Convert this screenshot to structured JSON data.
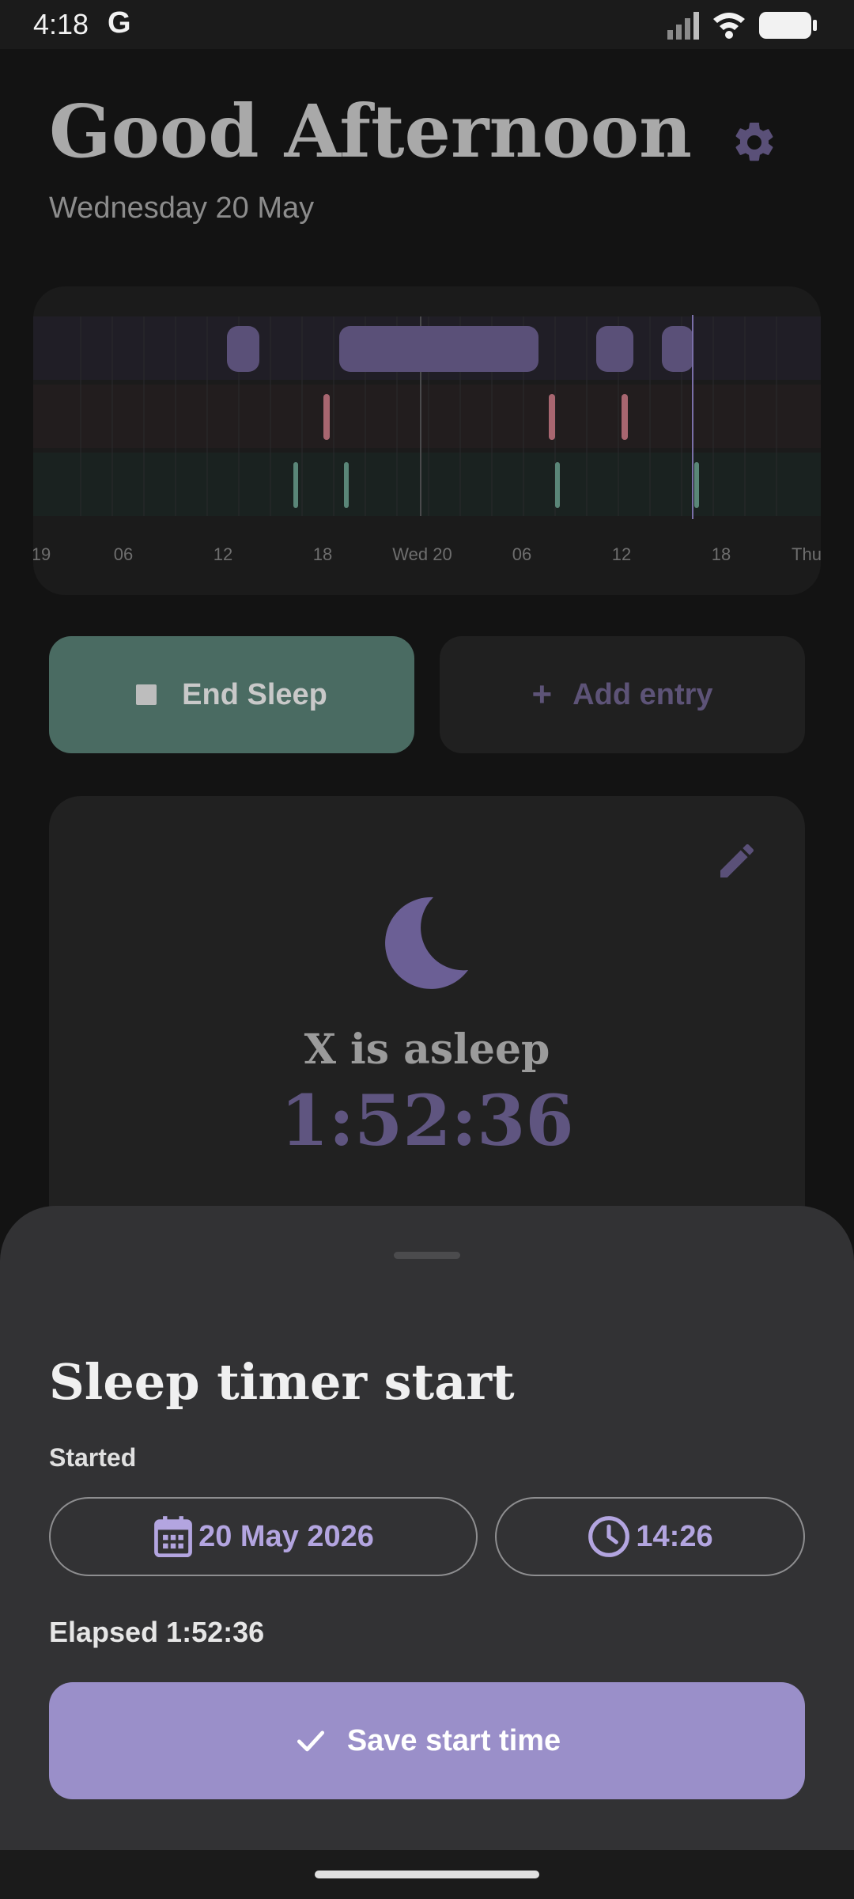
{
  "status_bar": {
    "time": "4:18",
    "google_glyph": "G"
  },
  "header": {
    "greeting": "Good Afternoon",
    "date": "Wednesday 20 May"
  },
  "timeline": {
    "tick_labels": [
      "19",
      "06",
      "12",
      "18",
      "Wed 20",
      "06",
      "12",
      "18",
      "Thu"
    ]
  },
  "actions": {
    "end_sleep": "End Sleep",
    "add_entry": "Add entry",
    "add_icon": "+"
  },
  "status_card": {
    "status_text": "X is asleep",
    "elapsed": "1:52:36"
  },
  "sheet": {
    "title": "Sleep timer start",
    "started_label": "Started",
    "date_value": "20 May 2026",
    "time_value": "14:26",
    "elapsed_line": "Elapsed 1:52:36",
    "save_label": "Save start time"
  },
  "colors": {
    "sleep_accent": "#5f5580",
    "end_button": "#4a6b62",
    "save_button": "#9a8fc9",
    "feed_marker": "#b06a72",
    "diaper_marker": "#5e8a7c"
  }
}
